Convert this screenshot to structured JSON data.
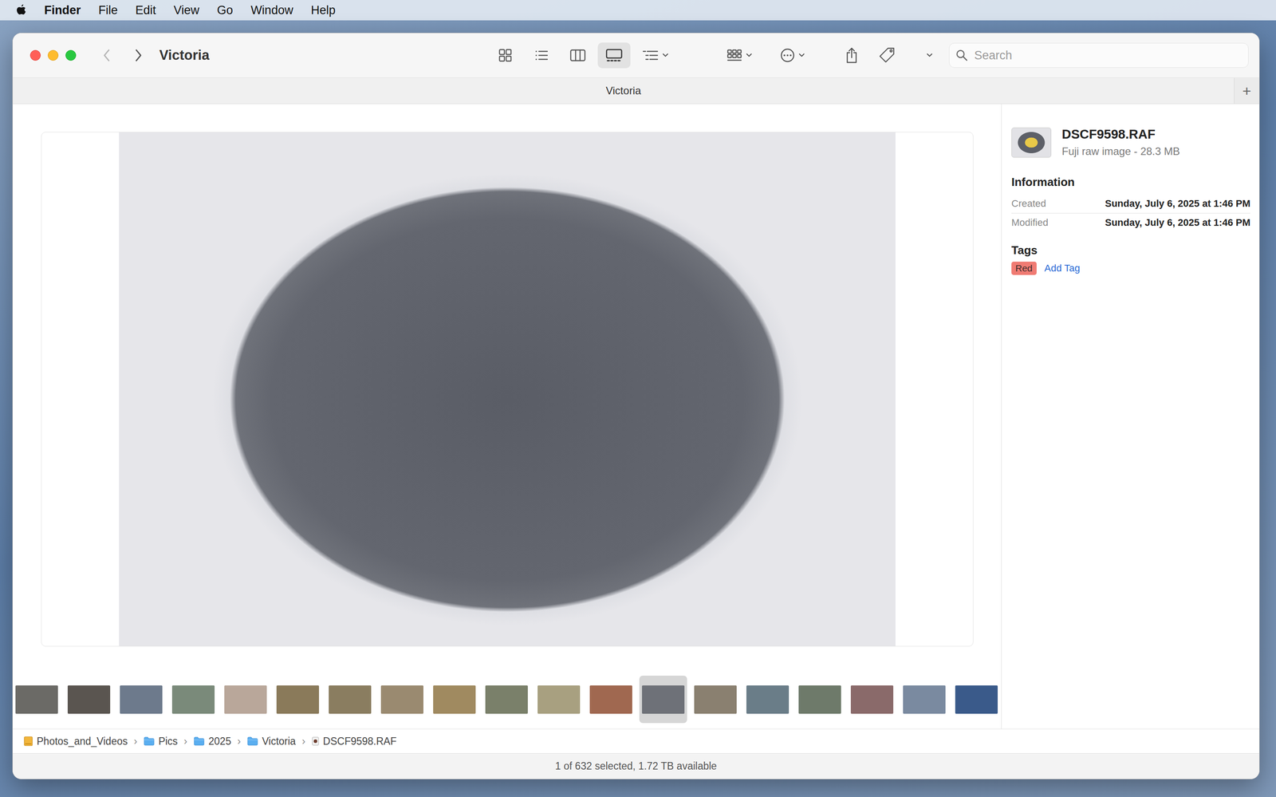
{
  "menubar": {
    "app": "Finder",
    "items": [
      "File",
      "Edit",
      "View",
      "Go",
      "Window",
      "Help"
    ]
  },
  "window": {
    "title": "Victoria"
  },
  "nav": {
    "back": {
      "disabled": true
    },
    "forward": {
      "disabled": false
    }
  },
  "toolbar": {
    "view_modes": [
      {
        "kind": "icons",
        "selected": false
      },
      {
        "kind": "list",
        "selected": false
      },
      {
        "kind": "columns",
        "selected": false
      },
      {
        "kind": "gallery",
        "selected": true
      }
    ],
    "search": {
      "placeholder": "Search"
    }
  },
  "tabs": [
    {
      "label": "Victoria",
      "selected": true
    }
  ],
  "tab_add": "+",
  "thumbnails": [
    {
      "selected": false,
      "color": "#6b6a66"
    },
    {
      "selected": false,
      "color": "#5a5550"
    },
    {
      "selected": false,
      "color": "#6d7a8c"
    },
    {
      "selected": false,
      "color": "#7a8a7a"
    },
    {
      "selected": false,
      "color": "#b9a79a"
    },
    {
      "selected": false,
      "color": "#8a7a5a"
    },
    {
      "selected": false,
      "color": "#8a7d60"
    },
    {
      "selected": false,
      "color": "#9a8a70"
    },
    {
      "selected": false,
      "color": "#a08a60"
    },
    {
      "selected": false,
      "color": "#7a806a"
    },
    {
      "selected": false,
      "color": "#a8a080"
    },
    {
      "selected": false,
      "color": "#a06850"
    },
    {
      "selected": true,
      "color": "#6e7178"
    },
    {
      "selected": false,
      "color": "#8a8070"
    },
    {
      "selected": false,
      "color": "#6a7d88"
    },
    {
      "selected": false,
      "color": "#6e7a6a"
    },
    {
      "selected": false,
      "color": "#8a6a6a"
    },
    {
      "selected": false,
      "color": "#7a8aa0"
    },
    {
      "selected": false,
      "color": "#3a5a8a"
    }
  ],
  "inspector": {
    "filename": "DSCF9598.RAF",
    "kind": "Fuji raw image - 28.3 MB",
    "information_title": "Information",
    "rows": [
      {
        "label": "Created",
        "value": "Sunday, July 6, 2025 at 1:46 PM"
      },
      {
        "label": "Modified",
        "value": "Sunday, July 6, 2025 at 1:46 PM"
      }
    ],
    "tags_title": "Tags",
    "tags": [
      {
        "label": "Red",
        "color": "#f07b73"
      }
    ],
    "add_tag": "Add Tag"
  },
  "path_bar": {
    "separator": "›",
    "items": [
      {
        "label": "Photos_and_Videos",
        "kind": "drive"
      },
      {
        "label": "Pics",
        "kind": "folder"
      },
      {
        "label": "2025",
        "kind": "folder"
      },
      {
        "label": "Victoria",
        "kind": "folder"
      },
      {
        "label": "DSCF9598.RAF",
        "kind": "file"
      }
    ]
  },
  "status_bar": "1 of 632 selected, 1.72 TB available"
}
